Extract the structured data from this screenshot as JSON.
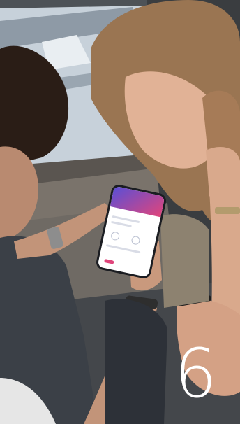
{
  "overlay": {
    "number": "6"
  },
  "scene": {
    "description_icons": [
      "person-left",
      "person-right",
      "smartphone",
      "train-window"
    ],
    "colors": {
      "window_snow": "#c9d4dd",
      "hair_right": "#9a7552",
      "hair_left": "#2a1d16",
      "jacket": "#3b4047",
      "seat": "#6f6a64"
    }
  }
}
